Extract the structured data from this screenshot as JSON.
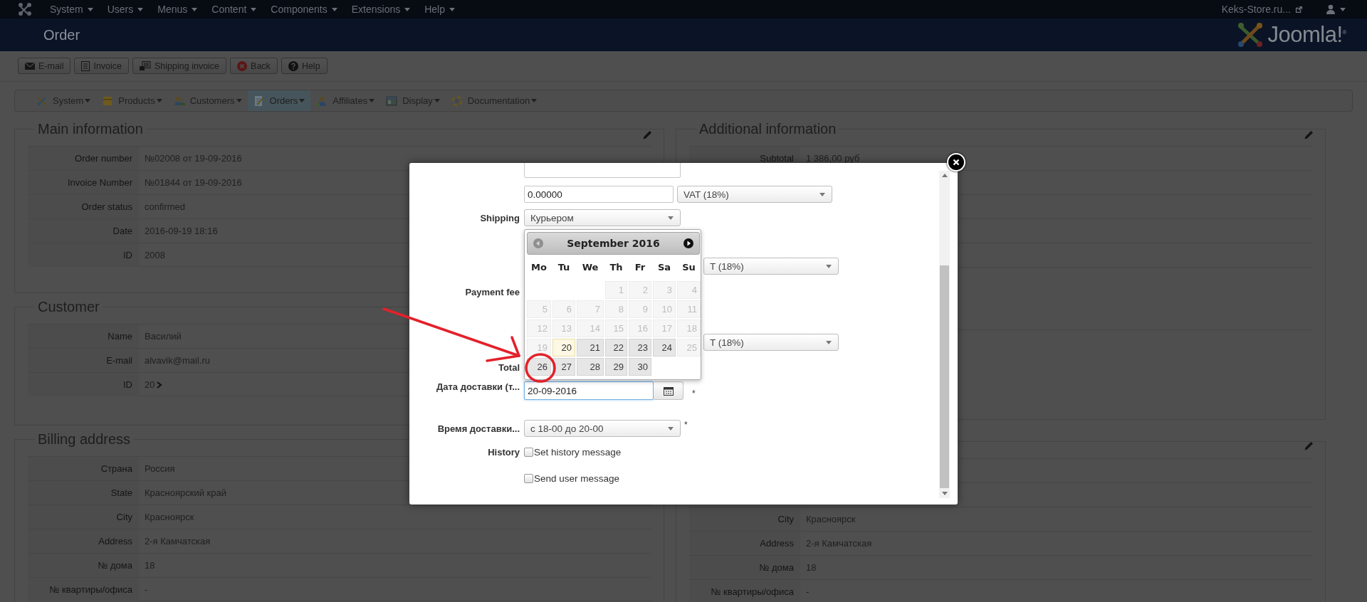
{
  "top_nav": {
    "menus": [
      {
        "label": "System"
      },
      {
        "label": "Users"
      },
      {
        "label": "Menus"
      },
      {
        "label": "Content"
      },
      {
        "label": "Components"
      },
      {
        "label": "Extensions"
      },
      {
        "label": "Help"
      }
    ],
    "site_link": "Keks-Store.ru..."
  },
  "header": {
    "title": "Order",
    "logo_text": "Joomla!$^{®}$"
  },
  "toolbar": {
    "buttons": [
      {
        "label": "E-mail",
        "kind": "email"
      },
      {
        "label": "Invoice",
        "kind": "invoice"
      },
      {
        "label": "Shipping invoice",
        "kind": "shipping"
      },
      {
        "label": "Back",
        "kind": "back"
      },
      {
        "label": "Help",
        "kind": "help"
      }
    ]
  },
  "submenu": {
    "items": [
      {
        "label": "System",
        "kind": "tools",
        "selected": false
      },
      {
        "label": "Products",
        "kind": "products",
        "selected": false
      },
      {
        "label": "Customers",
        "kind": "customers",
        "selected": false
      },
      {
        "label": "Orders",
        "kind": "orders",
        "selected": true
      },
      {
        "label": "Affiliates",
        "kind": "affiliates",
        "selected": false
      },
      {
        "label": "Display",
        "kind": "display",
        "selected": false
      },
      {
        "label": "Documentation",
        "kind": "documentation",
        "selected": false
      }
    ]
  },
  "main_information": {
    "title": "Main information",
    "edit_icon": true,
    "rows": [
      {
        "label": "Order number",
        "value": "№02008 от 19-09-2016"
      },
      {
        "label": "Invoice Number",
        "value": "№01844 от 19-09-2016"
      },
      {
        "label": "Order status",
        "value": "confirmed"
      },
      {
        "label": "Date",
        "value": "2016-09-19 18:16"
      },
      {
        "label": "ID",
        "value": "2008"
      }
    ]
  },
  "customer": {
    "title": "Customer",
    "edit_icon": false,
    "rows": [
      {
        "label": "Name",
        "value": "Василий"
      },
      {
        "label": "E-mail",
        "value": "alvavik@mail.ru"
      },
      {
        "label": "ID",
        "value": "20",
        "link": true
      }
    ]
  },
  "billing_address": {
    "title": "Billing address",
    "edit_icon": false,
    "rows": [
      {
        "label": "Страна",
        "value": "Россия"
      },
      {
        "label": "State",
        "value": "Красноярский край"
      },
      {
        "label": "City",
        "value": "Красноярск"
      },
      {
        "label": "Address",
        "value": "2-я Камчатская"
      },
      {
        "label": "№ дома",
        "value": "18"
      },
      {
        "label": "№ квартиры/офиса",
        "value": "-"
      }
    ]
  },
  "additional_information": {
    "title": "Additional information",
    "edit_icon": true,
    "rows": [
      {
        "label": "Subtotal",
        "value": "1 386,00 руб"
      }
    ]
  },
  "panel_4": {
    "edit_icon": true,
    "rows": [
      {
        "label": "City",
        "value": "Красноярск"
      },
      {
        "label": "Address",
        "value": "2-я Камчатская"
      },
      {
        "label": "№ дома",
        "value": "18"
      },
      {
        "label": "№ квартиры/офиса",
        "value": "-"
      }
    ]
  },
  "modal": {
    "rows": [
      {
        "kind": "clipped-field"
      },
      {
        "kind": "amount",
        "value": "0.00000",
        "select": "VAT (18%)"
      },
      {
        "kind": "select",
        "label": "Shipping",
        "value": "Курьером"
      },
      {
        "kind": "partial-select",
        "value": "T (18%)"
      },
      {
        "kind": "label",
        "label": "Payment fee"
      },
      {
        "kind": "partial-select",
        "value": "T (18%)"
      },
      {
        "kind": "label",
        "label": "Total"
      },
      {
        "kind": "date",
        "label": "Дата доставки (т...",
        "value": "20-09-2016",
        "required_mark": "*"
      },
      {
        "kind": "select",
        "label": "Время доставки...",
        "value": "с 18-00 до 20-00",
        "required_mark": "*"
      },
      {
        "kind": "checkbox",
        "label": "History",
        "text": "Set history message",
        "checked": false
      },
      {
        "kind": "checkbox",
        "text": "Send user message",
        "checked": false
      }
    ],
    "calendar": {
      "title": "September 2016",
      "weekdays": [
        "Mo",
        "Tu",
        "We",
        "Th",
        "Fr",
        "Sa",
        "Su"
      ],
      "weeks": [
        [
          {
            "kind": "blank"
          },
          {
            "kind": "blank"
          },
          {
            "kind": "blank"
          },
          {
            "kind": "day",
            "label": "1",
            "disabled": true,
            "today": false
          },
          {
            "kind": "day",
            "label": "2",
            "disabled": true,
            "today": false
          },
          {
            "kind": "day",
            "label": "3",
            "disabled": true,
            "today": false
          },
          {
            "kind": "day",
            "label": "4",
            "disabled": true,
            "today": false
          }
        ],
        [
          {
            "kind": "day",
            "label": "5",
            "disabled": true,
            "today": false
          },
          {
            "kind": "day",
            "label": "6",
            "disabled": true,
            "today": false
          },
          {
            "kind": "day",
            "label": "7",
            "disabled": true,
            "today": false
          },
          {
            "kind": "day",
            "label": "8",
            "disabled": true,
            "today": false
          },
          {
            "kind": "day",
            "label": "9",
            "disabled": true,
            "today": false
          },
          {
            "kind": "day",
            "label": "10",
            "disabled": true,
            "today": false
          },
          {
            "kind": "day",
            "label": "11",
            "disabled": true,
            "today": false
          }
        ],
        [
          {
            "kind": "day",
            "label": "12",
            "disabled": true,
            "today": false
          },
          {
            "kind": "day",
            "label": "13",
            "disabled": true,
            "today": false
          },
          {
            "kind": "day",
            "label": "14",
            "disabled": true,
            "today": false
          },
          {
            "kind": "day",
            "label": "15",
            "disabled": true,
            "today": false
          },
          {
            "kind": "day",
            "label": "16",
            "disabled": true,
            "today": false
          },
          {
            "kind": "day",
            "label": "17",
            "disabled": true,
            "today": false
          },
          {
            "kind": "day",
            "label": "18",
            "disabled": true,
            "today": false
          }
        ],
        [
          {
            "kind": "day",
            "label": "19",
            "disabled": true,
            "today": false
          },
          {
            "kind": "day",
            "label": "20",
            "disabled": false,
            "today": true
          },
          {
            "kind": "day",
            "label": "21",
            "disabled": false,
            "today": false
          },
          {
            "kind": "day",
            "label": "22",
            "disabled": false,
            "today": false
          },
          {
            "kind": "day",
            "label": "23",
            "disabled": false,
            "today": false
          },
          {
            "kind": "day",
            "label": "24",
            "disabled": false,
            "today": false
          },
          {
            "kind": "day",
            "label": "25",
            "disabled": true,
            "today": false
          }
        ],
        [
          {
            "kind": "day",
            "label": "26",
            "disabled": false,
            "today": false
          },
          {
            "kind": "day",
            "label": "27",
            "disabled": false,
            "today": false
          },
          {
            "kind": "day",
            "label": "28",
            "disabled": false,
            "today": false
          },
          {
            "kind": "day",
            "label": "29",
            "disabled": false,
            "today": false
          },
          {
            "kind": "day",
            "label": "30",
            "disabled": false,
            "today": false
          },
          {
            "kind": "blank"
          },
          {
            "kind": "blank"
          }
        ]
      ]
    }
  }
}
